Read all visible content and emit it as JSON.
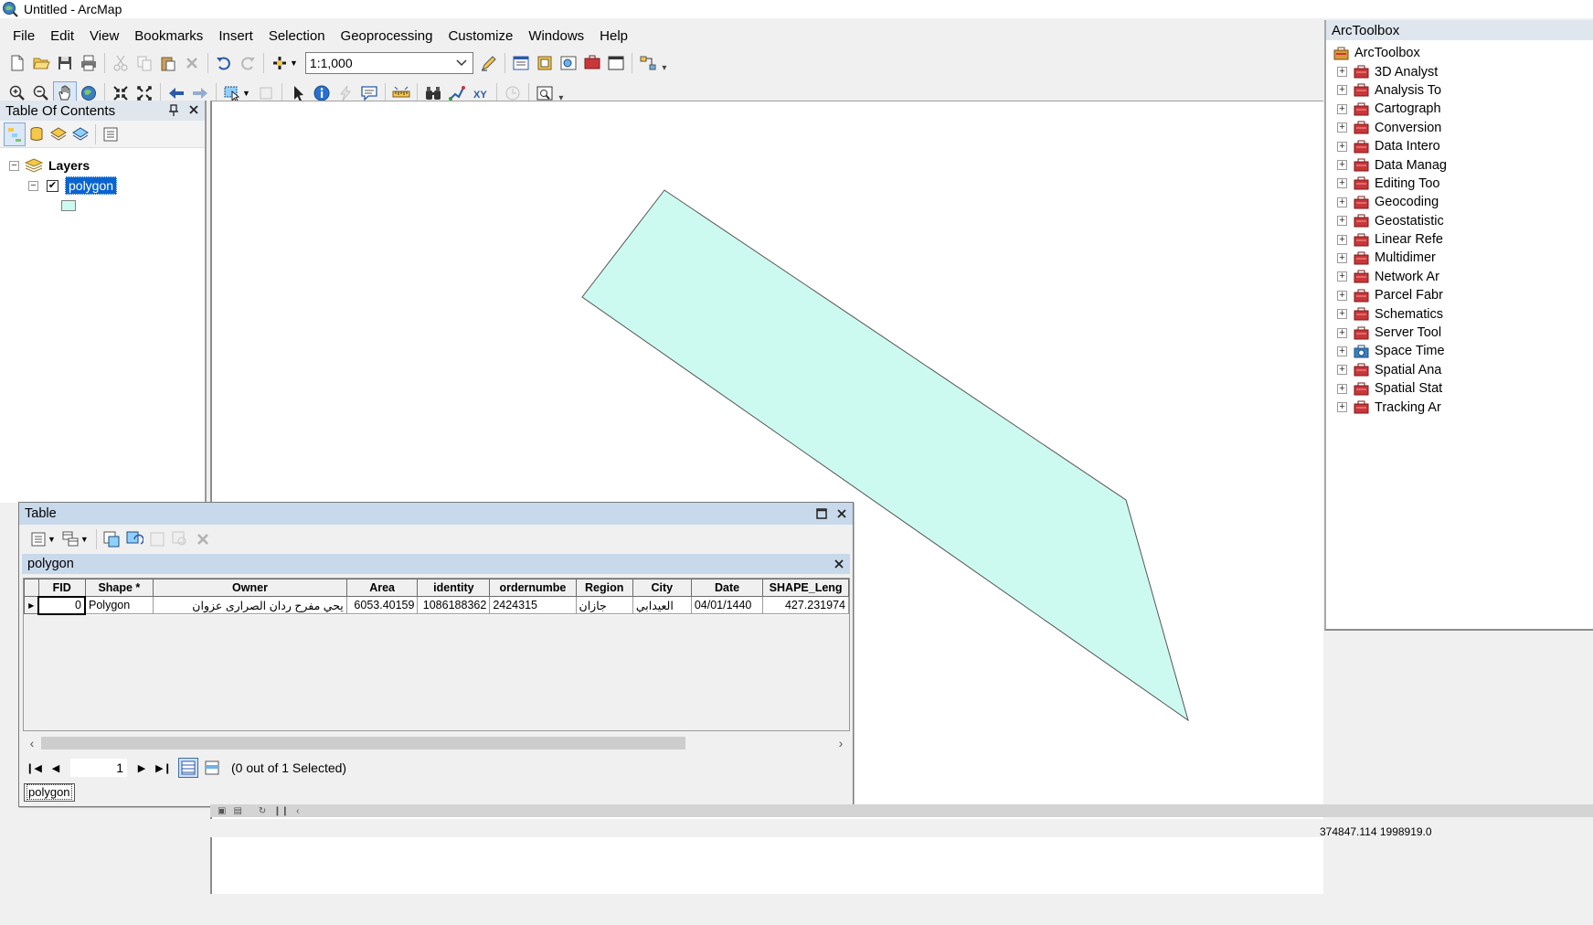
{
  "window": {
    "title": "Untitled - ArcMap"
  },
  "menu": [
    "File",
    "Edit",
    "View",
    "Bookmarks",
    "Insert",
    "Selection",
    "Geoprocessing",
    "Customize",
    "Windows",
    "Help"
  ],
  "toolbar": {
    "scale": "1:1,000"
  },
  "toc": {
    "title": "Table Of Contents",
    "root_label": "Layers",
    "layer_label": "polygon",
    "layer_checked": true,
    "symbol_color": "#cdfaf0"
  },
  "map": {
    "fill_color": "#cdfaf0",
    "stroke_color": "#555555"
  },
  "toolbox": {
    "title": "ArcToolbox",
    "root": "ArcToolbox",
    "items": [
      "3D Analyst",
      "Analysis To",
      "Cartograph",
      "Conversion",
      "Data Intero",
      "Data Manag",
      "Editing Too",
      "Geocoding",
      "Geostatistic",
      "Linear Refe",
      "Multidimer",
      "Network Ar",
      "Parcel Fabr",
      "Schematics",
      "Server Tool",
      "Space Time",
      "Spatial Ana",
      "Spatial Stat",
      "Tracking Ar"
    ]
  },
  "table": {
    "window_title": "Table",
    "tab_title": "polygon",
    "columns": [
      "FID",
      "Shape *",
      "Owner",
      "Area",
      "identity",
      "ordernumbe",
      "Region",
      "City",
      "Date",
      "SHAPE_Leng"
    ],
    "rows": [
      [
        "0",
        "Polygon",
        "يحي مفرح ردان الصرارى عزوان",
        "6053.40159",
        "1086188362",
        "2424315",
        "جازان",
        "العيدابي",
        "04/01/1440",
        "427.231974"
      ]
    ],
    "record": "1",
    "selection_status": "(0 out of 1 Selected)",
    "bottom_tab": "polygon"
  },
  "status": {
    "coordinates": "374847.114 1998919.0"
  }
}
